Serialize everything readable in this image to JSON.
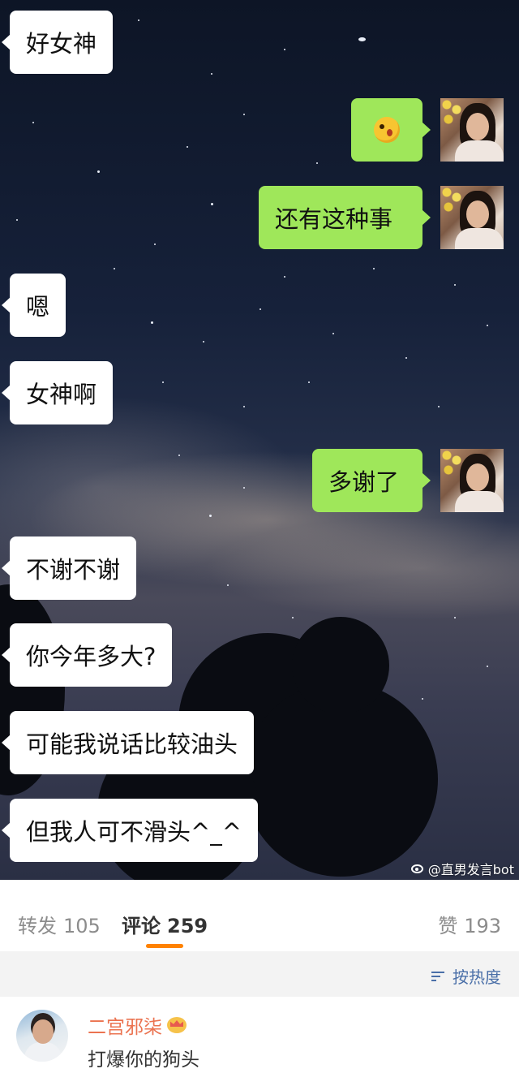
{
  "chat": {
    "messages": [
      {
        "side": "left",
        "text": "好女神"
      },
      {
        "side": "right",
        "text": "",
        "icon": "surprised-emoji-icon"
      },
      {
        "side": "right",
        "text": "还有这种事"
      },
      {
        "side": "left",
        "text": "嗯"
      },
      {
        "side": "left",
        "text": "女神啊"
      },
      {
        "side": "right",
        "text": "多谢了"
      },
      {
        "side": "left",
        "text": "不谢不谢"
      },
      {
        "side": "left",
        "text": "你今年多大?"
      },
      {
        "side": "left",
        "text": "可能我说话比较油头"
      },
      {
        "side": "left",
        "text": "但我人可不滑头^_^"
      }
    ],
    "colors": {
      "left_bubble": "#ffffff",
      "right_bubble": "#9fe75a"
    }
  },
  "watermark": {
    "text": "@直男发言bot",
    "icon": "weibo-icon"
  },
  "tabs": {
    "repost": {
      "label": "转发",
      "count": "105"
    },
    "comment": {
      "label": "评论",
      "count": "259"
    },
    "like": {
      "label": "赞",
      "count": "193"
    },
    "indicator_color": "#ff8200"
  },
  "sort": {
    "label": "按热度",
    "icon": "sort-icon"
  },
  "comment": {
    "user": "二宫邪柒",
    "badge_icon": "crown-badge-icon",
    "text": "打爆你的狗头",
    "name_color": "#eb7350"
  }
}
